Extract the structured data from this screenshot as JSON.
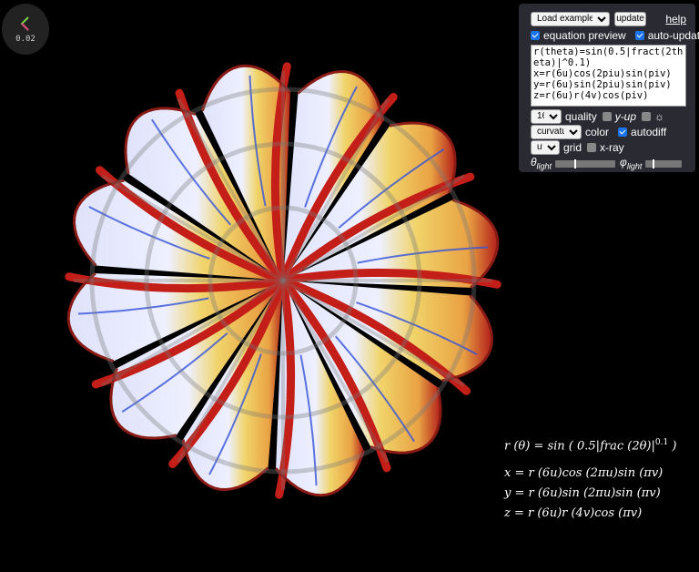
{
  "fps": "0.02",
  "panel": {
    "example_select": "Load example...",
    "update_label": "update",
    "help_label": "help",
    "equation_preview_label": "equation preview",
    "equation_preview_checked": true,
    "auto_update_label": "auto-update",
    "auto_update_checked": true,
    "equation_text": "r(theta)=sin(0.5|fract(2theta)|^0.1)\nx=r(6u)cos(2piu)sin(piv)\ny=r(6u)sin(2piu)sin(piv)\nz=r(6u)r(4v)cos(piv)",
    "quality_select": "16×",
    "quality_label": "quality",
    "y_up_label": "y-up",
    "y_up_checked": false,
    "sun_label": "☼",
    "sun_checked": false,
    "color_select": "curvature",
    "color_label": "color",
    "autodiff_label": "autodiff",
    "autodiff_checked": true,
    "grid_select": "uv",
    "grid_label": "grid",
    "xray_label": "x-ray",
    "xray_checked": false,
    "theta_light_label": "θ",
    "theta_light_sub": "light",
    "theta_light_value": 0.32,
    "phi_light_label": "φ",
    "phi_light_sub": "light",
    "phi_light_value": 0.2
  },
  "equations": {
    "line1": "r (θ) = sin ( 0.5|frac (2θ)|",
    "line1_sup": "0.1",
    "line1_end": " )",
    "line2": "x = r (6u)cos (2πu)sin (πv)",
    "line3": "y = r (6u)sin (2πu)sin (πv)",
    "line4": "z = r (6u)r (4v)cos (πv)"
  },
  "colors": {
    "panel_bg": "#2a2a33",
    "checkbox_on": "#1a73e8",
    "surface_red": "#c8201a",
    "surface_yellow": "#f0d060",
    "surface_blue": "#3050d0",
    "surface_light": "#e0e4f8"
  }
}
